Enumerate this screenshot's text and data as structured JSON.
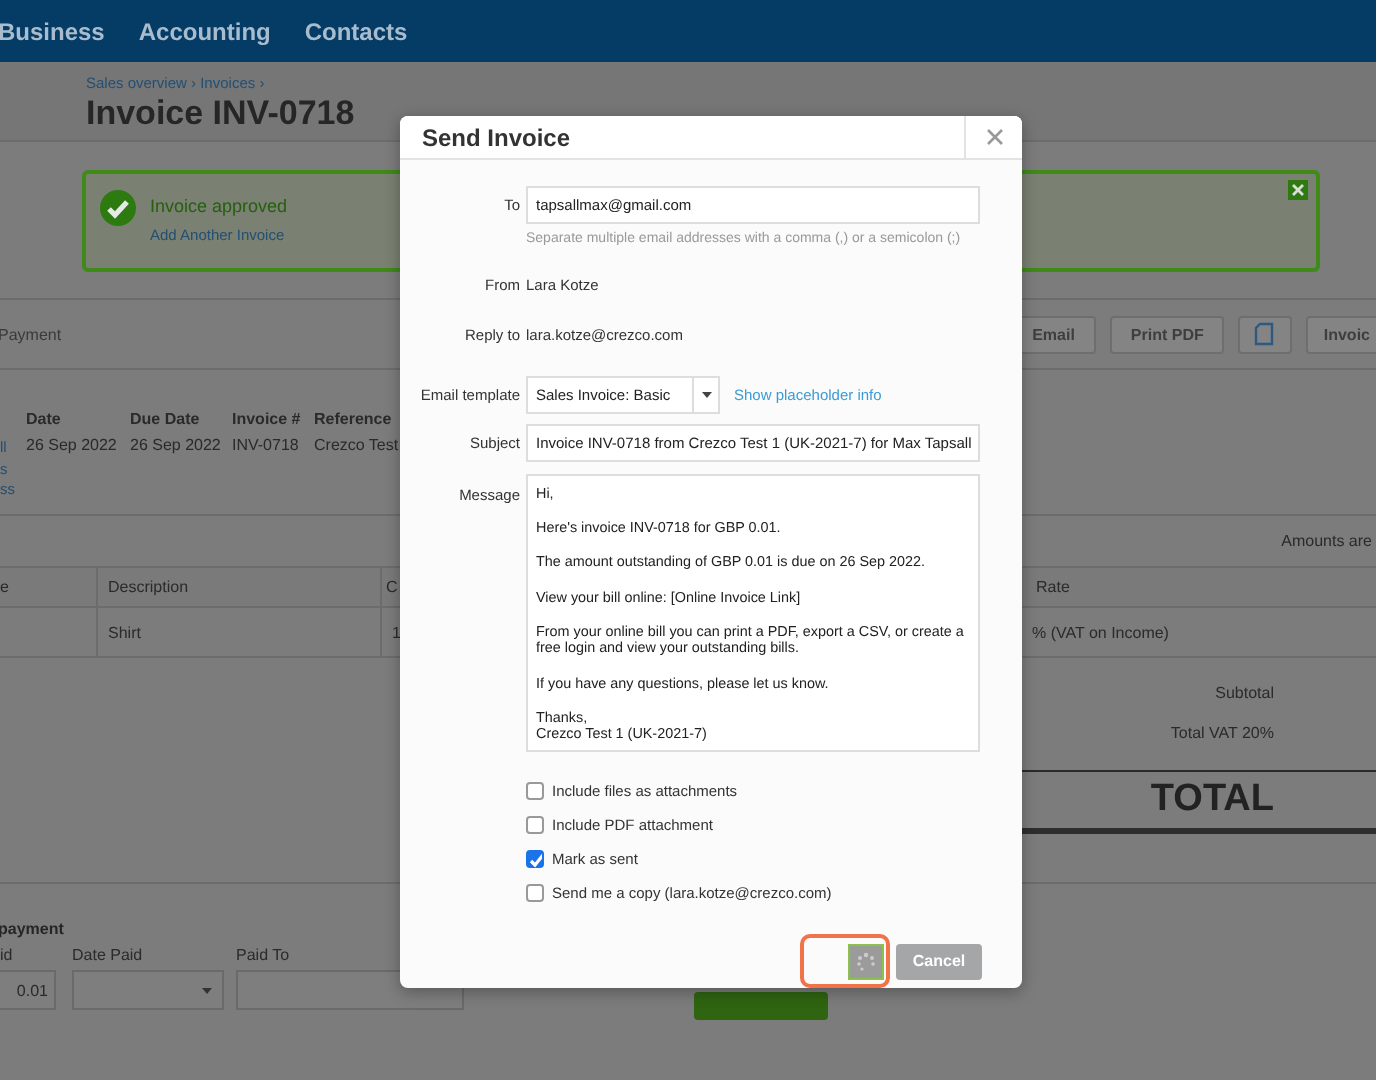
{
  "nav": {
    "items": [
      "Business",
      "Accounting",
      "Contacts"
    ]
  },
  "header": {
    "breadcrumb": "Sales overview › Invoices ›",
    "title": "Invoice INV-0718"
  },
  "alert": {
    "title": "Invoice approved",
    "link": "Add Another Invoice"
  },
  "toolbar": {
    "label": "Payment",
    "buttons": [
      {
        "kind": "text",
        "label": "Email"
      },
      {
        "kind": "text",
        "label": "Print PDF"
      },
      {
        "kind": "icon"
      },
      {
        "kind": "text",
        "label": "Invoic"
      }
    ]
  },
  "details": {
    "left_links": [
      "ll",
      "s",
      "ss"
    ],
    "columns": [
      "Date",
      "Due Date",
      "Invoice #",
      "Reference"
    ],
    "values": [
      "26 Sep 2022",
      "26 Sep 2022",
      "INV-0718",
      "Crezco Test"
    ]
  },
  "amounts_note": "Amounts are",
  "lines": {
    "columns": [
      "e",
      "Description",
      "C",
      "Rate"
    ],
    "rows": [
      {
        "description": "Shirt",
        "column_3": "1",
        "rate": "% (VAT on Income)"
      }
    ]
  },
  "totals": [
    {
      "kind": "normal",
      "label": "Subtotal"
    },
    {
      "kind": "normal",
      "label": "Total VAT  20%"
    },
    {
      "kind": "grand",
      "label": "TOTAL"
    }
  ],
  "payment": {
    "title": "payment",
    "fields": [
      {
        "kind": "text",
        "label": "id",
        "value": "0.01"
      },
      {
        "kind": "select",
        "label": "Date Paid"
      },
      {
        "kind": "text",
        "label": "Paid To"
      }
    ]
  },
  "dialog": {
    "title": "Send Invoice",
    "fields": [
      {
        "kind": "input",
        "label": "To",
        "value": "tapsallmax@gmail.com",
        "hint": "Separate multiple email addresses with a comma (,) or a semicolon (;)"
      },
      {
        "kind": "static",
        "label": "From",
        "value": "Lara Kotze"
      },
      {
        "kind": "static",
        "label": "Reply to",
        "value": "lara.kotze@crezco.com"
      },
      {
        "kind": "select",
        "label": "Email template",
        "value": "Sales Invoice: Basic",
        "link": "Show placeholder info"
      },
      {
        "kind": "input",
        "label": "Subject",
        "value": "Invoice INV-0718 from Crezco Test 1 (UK-2021-7) for Max Tapsall"
      },
      {
        "kind": "textarea",
        "label": "Message",
        "paragraphs": [
          "Hi,",
          "Here's invoice INV-0718 for GBP 0.01.",
          "The amount outstanding of GBP 0.01 is due on 26 Sep 2022.",
          "View your bill online: [Online Invoice Link]",
          "From your online bill you can print a PDF, export a CSV, or create a free login and view your outstanding bills.",
          "If you have any questions, please let us know.",
          "Thanks,\nCrezco Test 1 (UK-2021-7)"
        ]
      }
    ],
    "options": [
      {
        "label": "Include files as attachments",
        "checked": false
      },
      {
        "label": "Include PDF attachment",
        "checked": false
      },
      {
        "label": "Mark as sent",
        "checked": true
      },
      {
        "label": "Send me a copy (lara.kotze@crezco.com)",
        "checked": false
      }
    ],
    "buttons": [
      {
        "kind": "spinner",
        "highlighted": true
      },
      {
        "kind": "text",
        "label": "Cancel",
        "highlighted": false
      }
    ]
  }
}
